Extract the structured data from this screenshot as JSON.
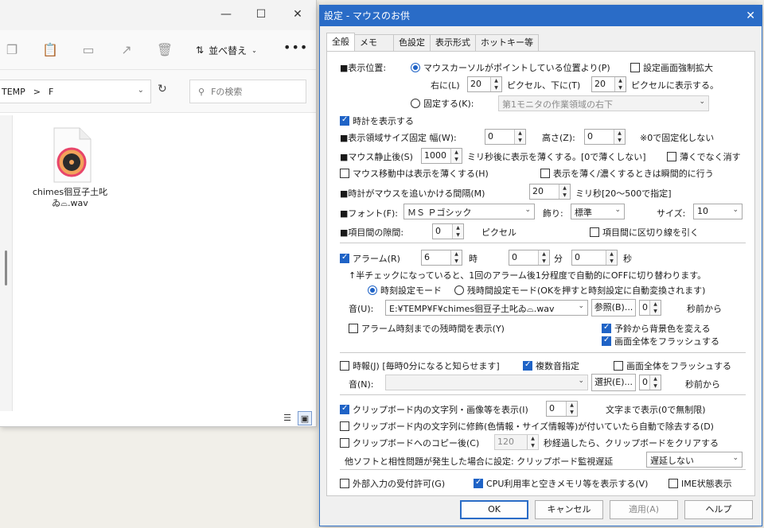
{
  "explorer": {
    "sort_label": "並べ替え",
    "more_label": "•••",
    "path_seg1": "TEMP",
    "path_sep": ">",
    "path_seg2": "F",
    "search_placeholder": "Fの検索",
    "file_name": "chimes徊豆子土叱ゐ⌓.wav"
  },
  "dialog": {
    "title": "設定 - マウスのお供",
    "close_glyph": "✕",
    "tabs": [
      "全般",
      "メモ",
      "色設定",
      "表示形式",
      "ホットキー等"
    ],
    "display_pos": {
      "label": "■表示位置:",
      "radio_mouse": "マウスカーソルがポイントしている位置より(P)",
      "force_enlarge": "設定画面強制拡大",
      "right_label": "右に(L)",
      "right_val": "20",
      "pixel_down": "ピクセル、下に(T)",
      "down_val": "20",
      "pixel_show": "ピクセルに表示する。",
      "radio_fixed": "固定する(K):",
      "fixed_select": "第1モニタの作業領域の右下"
    },
    "show_clock": "時計を表示する",
    "area_size": {
      "label": "■表示領域サイズ固定 幅(W):",
      "width_val": "0",
      "height_label": "高さ(Z):",
      "height_val": "0",
      "note": "※0で固定化しない"
    },
    "mouse_stop": {
      "label": "■マウス静止後(S)",
      "val": "1000",
      "suffix": "ミリ秒後に表示を薄くする。[0で薄くしない]",
      "erase": "薄くでなく消す"
    },
    "mouse_move_thin": "マウス移動中は表示を薄くする(H)",
    "instant": "表示を薄く/濃くするときは瞬間的に行う",
    "follow": {
      "label": "■時計がマウスを追いかける間隔(M)",
      "val": "20",
      "suffix": "ミリ秒[20〜500で指定]"
    },
    "font": {
      "label": "■フォント(F):",
      "font_val": "ＭＳ Ｐゴシック",
      "deco_label": "飾り:",
      "deco_val": "標準",
      "size_label": "サイズ:",
      "size_val": "10"
    },
    "spacing": {
      "label": "■項目間の隙間:",
      "val": "0",
      "unit": "ピクセル",
      "divider": "項目間に区切り線を引く"
    },
    "alarm": {
      "label": "アラーム(R)",
      "hour_val": "6",
      "hour_unit": "時",
      "min_val": "0",
      "min_unit": "分",
      "sec_val": "0",
      "sec_unit": "秒",
      "note": "↑半チェックになっていると、1回のアラーム後1分程度で自動的にOFFに切り替わります。",
      "mode_time": "時刻設定モード",
      "mode_remain": "残時間設定モード(OKを押すと時刻設定に自動変換されます)",
      "sound_label": "音(U):",
      "sound_val": "E:¥TEMP¥F¥chimes徊豆子土叱ゐ⌓.wav",
      "browse": "参照(B)...",
      "before_val": "0",
      "before_label": "秒前から",
      "show_remain": "アラーム時刻までの残時間を表示(Y)",
      "bg_change": "予鈴から背景色を変える",
      "flash": "画面全体をフラッシュする"
    },
    "chime": {
      "label": "時報(J) [毎時0分になると知らせます]",
      "multi": "複数音指定",
      "flash": "画面全体をフラッシュする",
      "sound_label": "音(N):",
      "select": "選択(E)...",
      "before_val": "0",
      "before_label": "秒前から"
    },
    "clipboard": {
      "show": "クリップボード内の文字列・画像等を表示(I)",
      "chars_val": "0",
      "chars_suffix": "文字まで表示(0で無制限)",
      "strip": "クリップボード内の文字列に修飾(色情報・サイズ情報等)が付いていたら自動で除去する(D)",
      "copy_label": "クリップボードへのコピー後(C)",
      "copy_val": "120",
      "copy_suffix": "秒経過したら、クリップボードをクリアする",
      "compat_label": "他ソフトと相性問題が発生した場合に設定: クリップボード監視遅延",
      "compat_val": "遅延しない"
    },
    "external": "外部入力の受付許可(G)",
    "cpu": "CPU利用率と空きメモリ等を表示する(V)",
    "ime": "IME状態表示",
    "buttons": {
      "ok": "OK",
      "cancel": "キャンセル",
      "apply": "適用(A)",
      "help": "ヘルプ"
    }
  }
}
